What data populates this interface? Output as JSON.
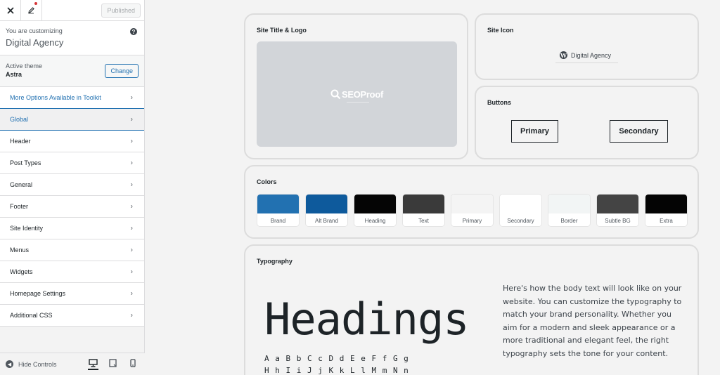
{
  "sidebar": {
    "published_label": "Published",
    "customizing_label": "You are customizing",
    "site_name": "Digital Agency",
    "active_theme_label": "Active theme",
    "theme_name": "Astra",
    "change_label": "Change",
    "items": [
      {
        "label": "More Options Available in Toolkit"
      },
      {
        "label": "Global"
      },
      {
        "label": "Header"
      },
      {
        "label": "Post Types"
      },
      {
        "label": "General"
      },
      {
        "label": "Footer"
      },
      {
        "label": "Site Identity"
      },
      {
        "label": "Menus"
      },
      {
        "label": "Widgets"
      },
      {
        "label": "Homepage Settings"
      },
      {
        "label": "Additional CSS"
      }
    ],
    "hide_controls_label": "Hide Controls"
  },
  "preview": {
    "site_title_logo": {
      "title": "Site Title & Logo",
      "logo_text": "SEOProof"
    },
    "site_icon": {
      "title": "Site Icon",
      "site_name": "Digital Agency"
    },
    "buttons": {
      "title": "Buttons",
      "primary_label": "Primary",
      "secondary_label": "Secondary"
    },
    "colors": {
      "title": "Colors",
      "swatches": [
        {
          "label": "Brand",
          "color": "#2271b1"
        },
        {
          "label": "Alt Brand",
          "color": "#0e5a9c"
        },
        {
          "label": "Heading",
          "color": "#050505"
        },
        {
          "label": "Text",
          "color": "#3a3a3a"
        },
        {
          "label": "Primary",
          "color": "#f4f4f4"
        },
        {
          "label": "Secondary",
          "color": "#ffffff"
        },
        {
          "label": "Border",
          "color": "#f2f5f5"
        },
        {
          "label": "Subtle BG",
          "color": "#444444"
        },
        {
          "label": "Extra",
          "color": "#040404"
        }
      ]
    },
    "typography": {
      "title": "Typography",
      "heading_sample": "Headings",
      "alphabet_line1": "A a B b C c D d E e F f G g",
      "alphabet_line2": "H h I i J j K k L l M m N n",
      "body_text": "Here's how the body text will look like on your website. You can customize the typography to match your brand personality. Whether you aim for a modern and sleek appearance or a more traditional and elegant feel, the right typography sets the tone for your content."
    }
  }
}
